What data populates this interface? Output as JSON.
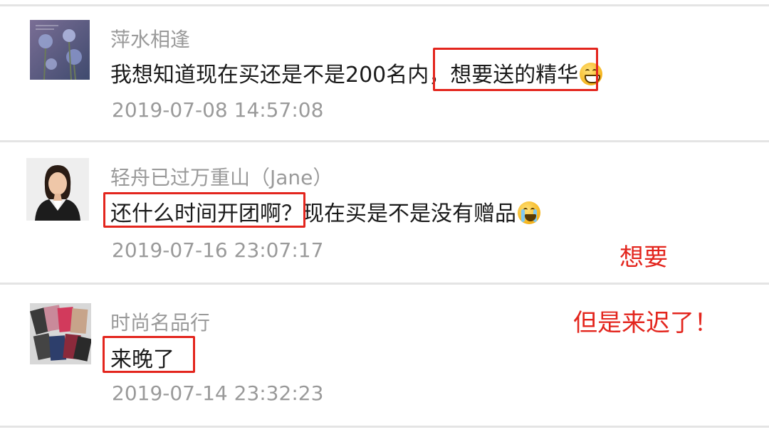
{
  "comments": [
    {
      "username": "萍水相逢",
      "text_highlight_pre": "我想知道现在买还是不是200名内，",
      "text_highlight": "想要送的精华",
      "text_post": "",
      "emoji": "grinning-face-icon",
      "time": "2019-07-08 14:57:08",
      "avatar": "blue-flower-photo"
    },
    {
      "username": "轻舟已过万重山（Jane）",
      "text_highlight_pre": "",
      "text_highlight": "还什么时间开团啊？",
      "text_post": "现在买是不是没有赠品",
      "emoji": "crying-face-icon",
      "time": "2019-07-16 23:07:17",
      "avatar": "woman-portrait-photo"
    },
    {
      "username": "时尚名品行",
      "text_highlight_pre": "",
      "text_highlight": "来晚了",
      "text_post": "",
      "emoji": "",
      "time": "2019-07-14 23:32:23",
      "avatar": "colorful-wallets-photo"
    }
  ],
  "annotations": {
    "want": "想要",
    "but_late": "但是来迟了！"
  },
  "colors": {
    "highlight": "#e3251d",
    "muted": "#9a9a9a",
    "text": "#1a1a1a",
    "divider": "#e4e4e4"
  }
}
